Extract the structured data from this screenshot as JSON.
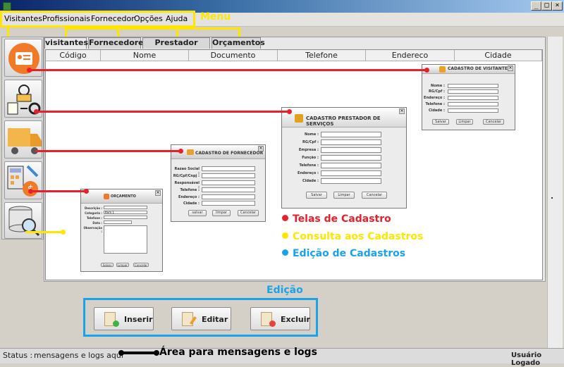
{
  "window": {
    "minimize": "_",
    "maximize": "□",
    "close": "×"
  },
  "menu": {
    "items": [
      "Visitantes",
      "Profissionais",
      "Fornecedor",
      "Opções",
      "Ajuda"
    ],
    "annotation": "Menu"
  },
  "tabs": [
    "visitantes",
    "Fornecedores",
    "Prestador Serviço",
    "Orçamentos"
  ],
  "table": {
    "columns": [
      "Código",
      "Nome",
      "Documento",
      "Telefone",
      "Endereco",
      "Cidade"
    ]
  },
  "sidebar": {
    "items": [
      {
        "icon": "visitor-card-icon"
      },
      {
        "icon": "service-provider-icon"
      },
      {
        "icon": "truck-icon"
      },
      {
        "icon": "calculator-money-icon"
      },
      {
        "icon": "database-search-icon"
      }
    ]
  },
  "forms": {
    "visitante": {
      "title": "CADASTRO DE VISITANTE",
      "fields": [
        "Nome :",
        "RG/Cpf :",
        "Endereço :",
        "Telefone :",
        "Cidade :"
      ],
      "buttons": [
        "Salvar",
        "Limpar",
        "Cancelar"
      ]
    },
    "prestador": {
      "title": "CADASTRO PRESTADOR DE SERVIÇOS",
      "fields": [
        "Nome :",
        "RG/Cpf :",
        "Empresa :",
        "Função :",
        "Telefone :",
        "Endereço :",
        "Cidade :"
      ],
      "buttons": [
        "Salvar",
        "Limpar",
        "Cancelar"
      ]
    },
    "fornecedor": {
      "title": "CADASTRO DE FORNECEDOR",
      "fields": [
        "Razao Social :",
        "RG/Cpf/Cnpj :",
        "Responsável :",
        "Telefone :",
        "Endereço :",
        "Cidade :"
      ],
      "buttons": [
        "salvar",
        "limpar",
        "Cancelar"
      ]
    },
    "orcamento": {
      "title": "ORÇAMENTO",
      "fields": [
        "Descrição :",
        "Categoria :",
        "Telefone :",
        "Data :",
        "Observação :"
      ],
      "category_value": "Item 1",
      "buttons": [
        "Salvar",
        "Limpar",
        "Cancelar"
      ]
    }
  },
  "legend": {
    "red": "Telas de Cadastro",
    "yellow": "Consulta aos Cadastros",
    "blue": "Edição de Cadastros"
  },
  "edit": {
    "title": "Edição",
    "insert": "Inserir",
    "edit": "Editar",
    "delete": "Excluir"
  },
  "status": {
    "label": "Status :",
    "message": "mensagens e logs aqui",
    "annotation": "Área para mensagens e logs",
    "user": "Usuário Logado"
  },
  "colors": {
    "red": "#e8202a",
    "yellow": "#ffe600",
    "blue": "#1aa3e8"
  }
}
